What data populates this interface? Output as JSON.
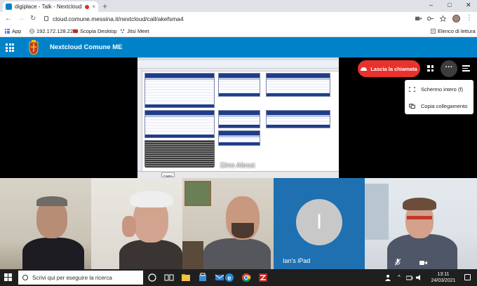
{
  "browser": {
    "tab_title": "digiplace - Talk - Nextcloud",
    "tab_close": "×",
    "new_tab": "+",
    "url": "cloud.comune.messina.it/nextcloud/call/akefsma4",
    "window_controls": {
      "minimize": "–",
      "maximize": "□",
      "close": "✕"
    },
    "bookmarks": {
      "apps": "App",
      "ip": "192.172.128.22",
      "scopia": "Scopia Desktop",
      "jitsi": "Jitsi Meet",
      "reading_list": "Elenco di lettura"
    }
  },
  "nextcloud": {
    "title": "Nextcloud Comune ME",
    "accent": "#0082c9"
  },
  "call": {
    "screen_share_owner": "Dino Alessi",
    "leave_label": "Lascia la chiamata",
    "more_label": "···",
    "menu": {
      "fullscreen": "Schermo intero (f)",
      "copy_link": "Copia collegamento"
    },
    "ipad_initial": "I",
    "ipad_name": "Ian's iPad",
    "sheet_tab": "Foglio1"
  },
  "taskbar": {
    "search_placeholder": "Scrivi qui per eseguire la ricerca",
    "time": "13:11",
    "date": "24/03/2021"
  },
  "colors": {
    "leave_red": "#e9322d",
    "ipad_blue": "#1e70b0"
  }
}
